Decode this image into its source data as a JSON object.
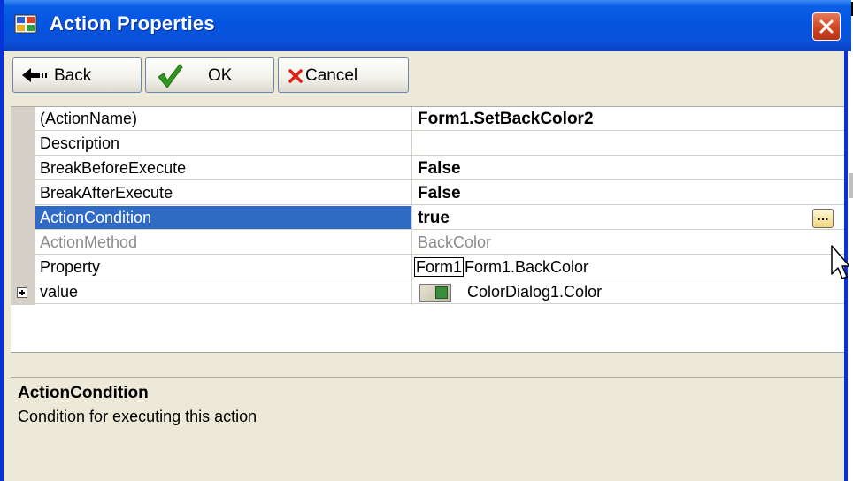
{
  "window": {
    "title": "Action Properties"
  },
  "toolbar": {
    "back_label": "Back",
    "ok_label": "OK",
    "cancel_label": "Cancel"
  },
  "properties": [
    {
      "name": "(ActionName)",
      "value": "Form1.SetBackColor2"
    },
    {
      "name": "Description",
      "value": ""
    },
    {
      "name": "BreakBeforeExecute",
      "value": "False"
    },
    {
      "name": "BreakAfterExecute",
      "value": "False"
    },
    {
      "name": "ActionCondition",
      "value": "true"
    },
    {
      "name": "ActionMethod",
      "value": "BackColor"
    },
    {
      "name": "Property",
      "value_prefix": "Form1",
      "value": "Form1.BackColor"
    },
    {
      "name": "value",
      "value": "ColorDialog1.Color"
    }
  ],
  "help": {
    "title": "ActionCondition",
    "description": "Condition for executing this action"
  },
  "colors": {
    "titlebar": "#0454e0",
    "selection": "#316ac5",
    "window_bg": "#ece9d8"
  },
  "icons": [
    "app-icon",
    "close-icon",
    "back-arrow-icon",
    "checkmark-icon",
    "cross-icon",
    "ellipsis-icon",
    "expand-plus-icon",
    "color-swatch-icon",
    "mouse-cursor-icon"
  ]
}
